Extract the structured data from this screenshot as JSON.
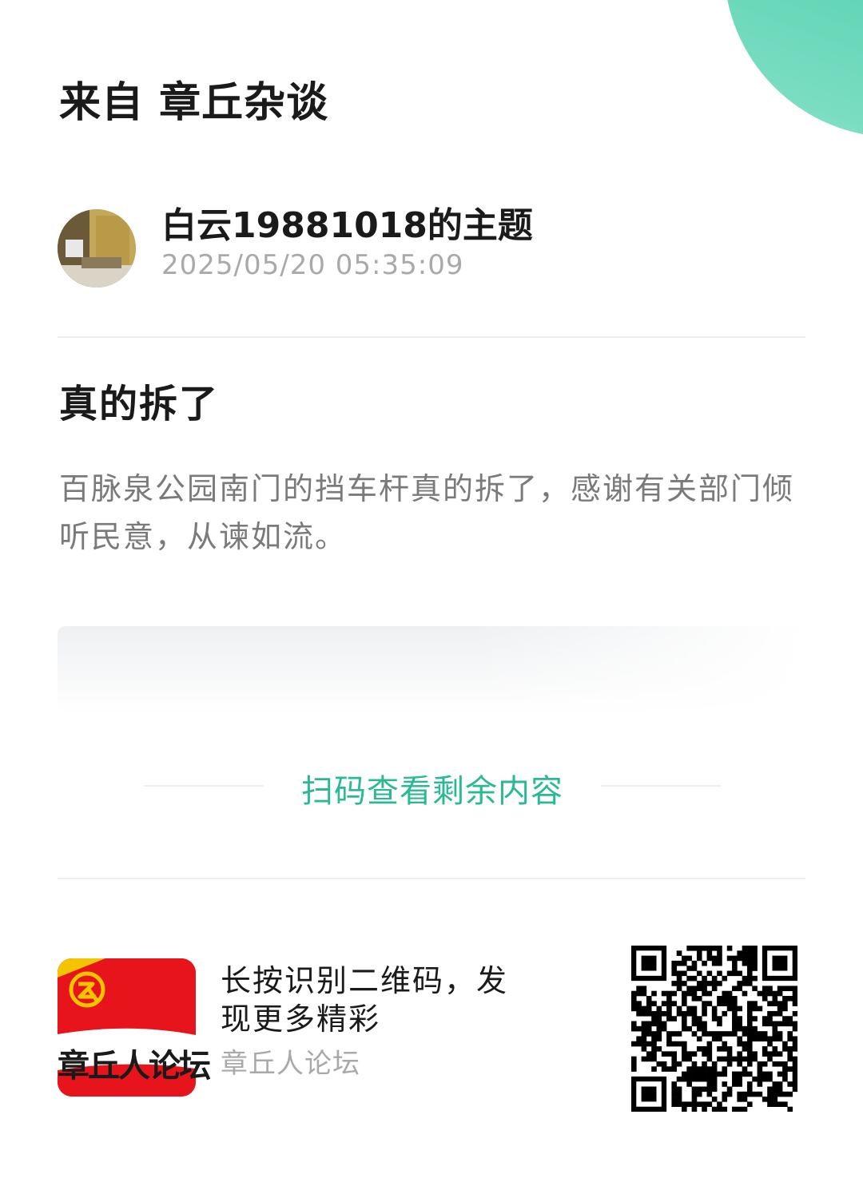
{
  "header": {
    "source_title": "来自 章丘杂谈"
  },
  "author": {
    "name": "白云19881018的主题",
    "time": "2025/05/20 05:35:09"
  },
  "post": {
    "title": "真的拆了",
    "body": "百脉泉公园南门的挡车杆真的拆了，感谢有关部门倾听民意，从谏如流。"
  },
  "more": {
    "label": "扫码查看剩余内容"
  },
  "footer": {
    "logo_text": "章丘人论坛",
    "qr_prompt": "长按识别二维码，发现更多精彩",
    "forum_name": "章丘人论坛"
  },
  "colors": {
    "accent": "#2bb894",
    "logo_red": "#e8141c",
    "logo_yellow": "#f5c400"
  },
  "icons": {
    "qr": "qr-code-icon",
    "logo_mark": "forum-logo-mark-icon"
  }
}
